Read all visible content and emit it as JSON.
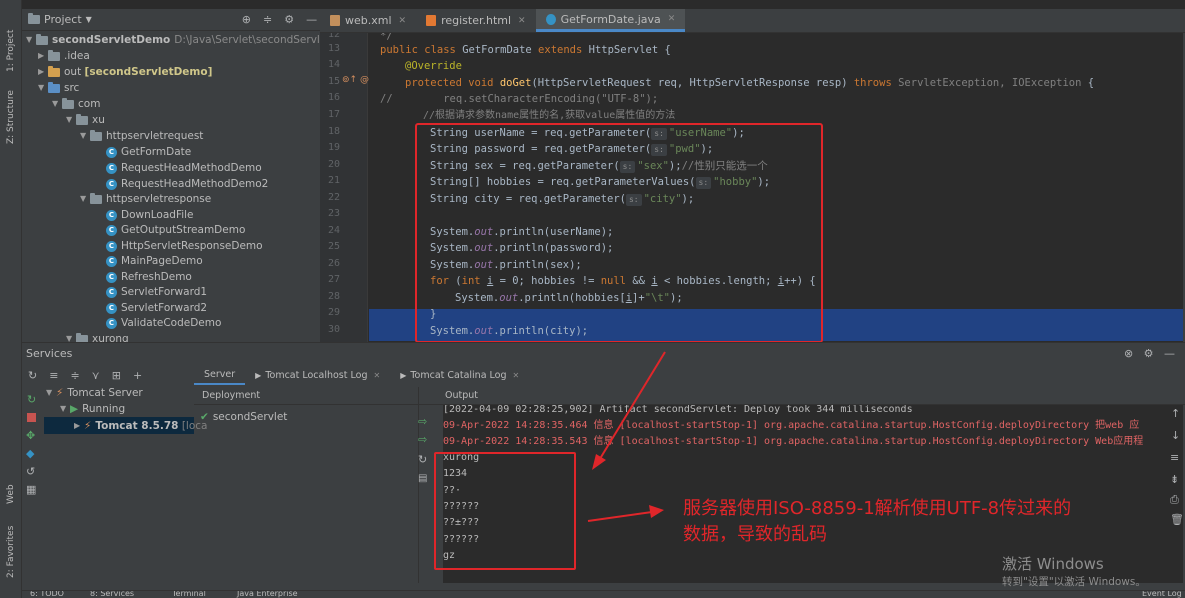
{
  "side_tabs": {
    "project": "1: Project",
    "structure": "Z: Structure",
    "web": "Web",
    "favorites": "2: Favorites"
  },
  "project": {
    "title": "Project",
    "tree": [
      {
        "label": "secondServletDemo",
        "path": "D:\\Java\\Servlet\\secondServletDem",
        "type": "module"
      },
      {
        "label": ".idea",
        "type": "folder"
      },
      {
        "label": "out",
        "extra": "[secondServletDemo]",
        "type": "folder-orange"
      },
      {
        "label": "src",
        "type": "folder-blue"
      },
      {
        "label": "com",
        "type": "package"
      },
      {
        "label": "xu",
        "type": "package"
      },
      {
        "label": "httpservletrequest",
        "type": "package"
      },
      {
        "label": "GetFormDate",
        "type": "class"
      },
      {
        "label": "RequestHeadMethodDemo",
        "type": "class"
      },
      {
        "label": "RequestHeadMethodDemo2",
        "type": "class"
      },
      {
        "label": "httpservletresponse",
        "type": "package"
      },
      {
        "label": "DownLoadFile",
        "type": "class"
      },
      {
        "label": "GetOutputStreamDemo",
        "type": "class"
      },
      {
        "label": "HttpServletResponseDemo",
        "type": "class"
      },
      {
        "label": "MainPageDemo",
        "type": "class"
      },
      {
        "label": "RefreshDemo",
        "type": "class"
      },
      {
        "label": "ServletForward1",
        "type": "class"
      },
      {
        "label": "ServletForward2",
        "type": "class"
      },
      {
        "label": "ValidateCodeDemo",
        "type": "class"
      },
      {
        "label": "xurong",
        "type": "package"
      }
    ]
  },
  "editor_tabs": [
    {
      "label": "web.xml",
      "active": false
    },
    {
      "label": "register.html",
      "active": false
    },
    {
      "label": "GetFormDate.java",
      "active": true
    }
  ],
  "code": {
    "line_numbers": [
      "12",
      "13",
      "14",
      "15",
      "16",
      "17",
      "18",
      "19",
      "20",
      "21",
      "22",
      "23",
      "24",
      "25",
      "26",
      "27",
      "28",
      "29",
      "30"
    ],
    "l12": "*/",
    "l13_kw": "public class ",
    "l13_name": "GetFormDate ",
    "l13_kw2": "extends ",
    "l13_rest": "HttpServlet {",
    "l14": "@Override",
    "l15_kw": "protected void ",
    "l15_fn": "doGet",
    "l15_a": "(HttpServletRequest req, HttpServletResponse resp) ",
    "l15_kw2": "throws ",
    "l15_exc": "ServletException, IOException",
    "l15_end": " {",
    "l16_prefix": "//",
    "l16": "        req.setCharacterEncoding(\"UTF-8\");",
    "l17": "//根据请求参数name属性的名,获取value属性值的方法",
    "params": [
      {
        "decl": "String userName = req.getParameter(",
        "hint": "s:",
        "arg": "\"userName\"",
        "tail": ");"
      },
      {
        "decl": "String password = req.getParameter(",
        "hint": "s:",
        "arg": "\"pwd\"",
        "tail": ");"
      },
      {
        "decl": "String sex = req.getParameter(",
        "hint": "s:",
        "arg": "\"sex\"",
        "tail": ");",
        "comment": "//性别只能选一个"
      },
      {
        "decl": "String[] hobbies = req.getParameterValues(",
        "hint": "s:",
        "arg": "\"hobby\"",
        "tail": ");"
      },
      {
        "decl": "String city = req.getParameter(",
        "hint": "s:",
        "arg": "\"city\"",
        "tail": ");"
      }
    ],
    "printlns": [
      "userName",
      "password",
      "sex"
    ],
    "sys": "System.",
    "out": "out",
    "println": ".println(",
    "l27_for": "for ",
    "l27_a": "(",
    "l27_int": "int ",
    "l27_i": "i",
    "l27_b": " = 0; hobbies != ",
    "l27_null": "null",
    "l27_c": " && ",
    "l27_d": " < hobbies.length; ",
    "l27_e": "++) {",
    "l28_a": "hobbies[",
    "l28_b": "]+",
    "l28_str": "\"\\t\"",
    "l28_c": ");",
    "l29": "}",
    "l30_arg": "city",
    "l30_end": ");"
  },
  "services": {
    "title": "Services",
    "server": "Tomcat Server",
    "running": "Running",
    "instance": "Tomcat 8.5.78",
    "instance_suffix": "[loca",
    "tabs": [
      "Server",
      "Tomcat Localhost Log",
      "Tomcat Catalina Log"
    ],
    "deployment_header": "Deployment",
    "deployment_item": "secondServlet",
    "output_header": "Output",
    "output_lines": [
      {
        "text": "[2022-04-09 02:28:25,902] Artifact secondServlet: Deploy took 344 milliseconds",
        "color": "#bbbbbb"
      },
      {
        "text": "09-Apr-2022 14:28:35.464 信息 [localhost-startStop-1] org.apache.catalina.startup.HostConfig.deployDirectory 把web 应",
        "color": "#e06464"
      },
      {
        "text": "09-Apr-2022 14:28:35.543 信息 [localhost-startStop-1] org.apache.catalina.startup.HostConfig.deployDirectory Web应用程",
        "color": "#e06464"
      },
      {
        "text": "xurong",
        "color": "#bbbbbb"
      },
      {
        "text": "1234",
        "color": "#bbbbbb"
      },
      {
        "text": "??·",
        "color": "#bbbbbb"
      },
      {
        "text": "??????",
        "color": "#bbbbbb"
      },
      {
        "text": "??±???",
        "color": "#bbbbbb"
      },
      {
        "text": "??????",
        "color": "#bbbbbb"
      },
      {
        "text": "gz",
        "color": "#bbbbbb"
      }
    ]
  },
  "annotation": {
    "line1": "服务器使用ISO-8859-1解析使用UTF-8传过来的",
    "line2": "数据，导致的乱码"
  },
  "watermark": {
    "line1": "激活 Windows",
    "line2": "转到\"设置\"以激活 Windows。"
  },
  "status_bar": {
    "todo": "6: TODO",
    "services": "8: Services",
    "terminal": "Terminal",
    "java_enterprise": "Java Enterprise",
    "event_log": "Event Log"
  },
  "colors": {
    "highlight": "#e0262a",
    "selection": "#214283",
    "accent": "#4a88c7"
  }
}
